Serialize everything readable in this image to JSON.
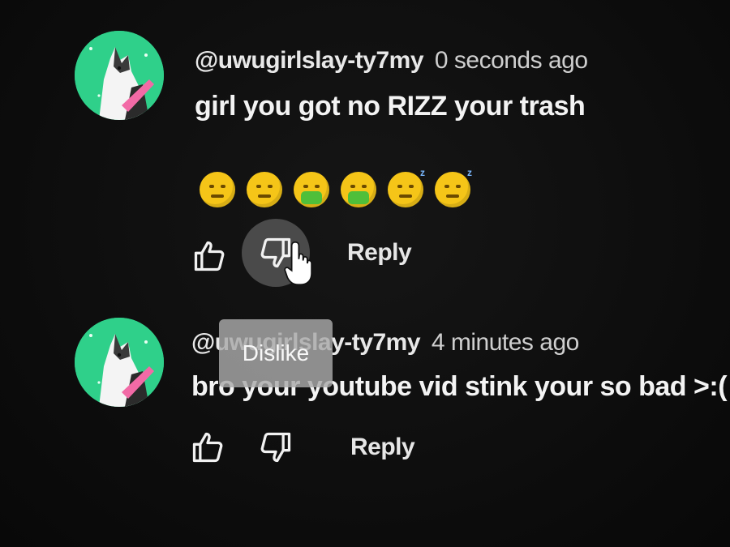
{
  "comments": [
    {
      "author": "@uwugirlslay-ty7my",
      "timestamp": "0 seconds ago",
      "text": "girl you got no RIZZ your trash",
      "emojis": [
        "woozy-face",
        "woozy-face",
        "vomiting-face",
        "vomiting-face",
        "sleeping-face",
        "sleeping-face"
      ],
      "reply_label": "Reply",
      "dislike_hovered": true
    },
    {
      "author": "@uwugirlslay-ty7my",
      "timestamp": "4 minutes ago",
      "text": "bro your youtube vid stink your so bad >:(",
      "reply_label": "Reply"
    }
  ],
  "tooltip": {
    "label": "Dislike"
  },
  "colors": {
    "background": "#0f0f0f",
    "avatar_bg": "#2fd08a",
    "hover_circle": "#4a4a4a",
    "tooltip_bg": "#a8a8a8"
  },
  "icons": [
    "thumbs-up-icon",
    "thumbs-down-icon",
    "hand-pointer-cursor-icon"
  ]
}
